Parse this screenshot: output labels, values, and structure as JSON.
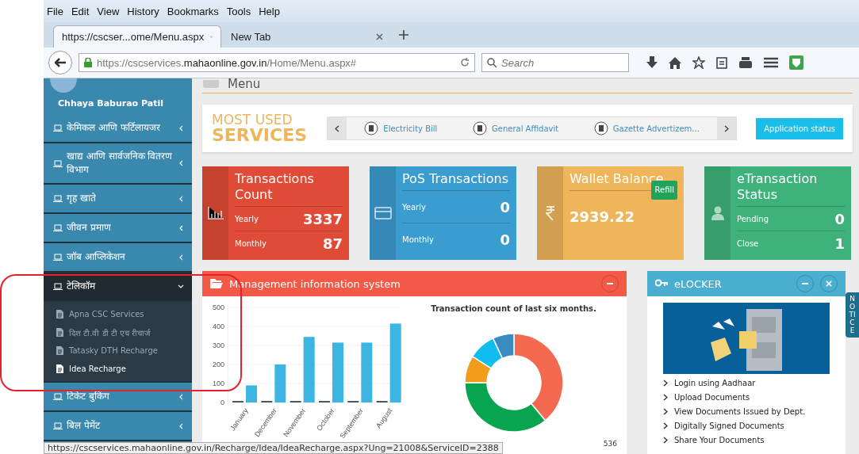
{
  "menu_bar": [
    "File",
    "Edit",
    "View",
    "History",
    "Bookmarks",
    "Tools",
    "Help"
  ],
  "tabs": [
    {
      "label": "https://cscser...ome/Menu.aspx",
      "selected": true
    },
    {
      "label": "New Tab",
      "selected": false
    }
  ],
  "address_bar": {
    "url": "https://cscservices.**mahaonline.gov.in**/Home/Menu.aspx#"
  },
  "search": {
    "placeholder": "Search"
  },
  "sidebar": {
    "user_name": "Chhaya Baburao Patil",
    "items": [
      {
        "label": "केमिकल आणि फर्टिलायजर",
        "expanded": false
      },
      {
        "label": "खाद्य आणि सार्वजनिक वितरण विभाग",
        "expanded": false
      },
      {
        "label": "गृह खाते",
        "expanded": false
      },
      {
        "label": "जीवन प्रमाण",
        "expanded": false
      },
      {
        "label": "जॉब आप्लिकेशन",
        "expanded": false
      },
      {
        "label": "टेलिकॉम",
        "expanded": true,
        "children": [
          {
            "label": "Apna CSC Services",
            "selected": false
          },
          {
            "label": "दिश टी.वी डी टी एच रीचार्ज",
            "selected": false
          },
          {
            "label": "Tatasky DTH Recharge",
            "selected": false
          },
          {
            "label": "Idea Recharge",
            "selected": true
          }
        ]
      },
      {
        "label": "टिकेट बुकिंग",
        "expanded": false
      },
      {
        "label": "बिल पेमेंट",
        "expanded": false
      }
    ]
  },
  "page_title": "Menu",
  "most_used": {
    "title_top": "MOST USED",
    "title_bottom": "SERVICES",
    "services": [
      "Electricity Bill",
      "General Affidavit",
      "Gazette Advertizem..."
    ],
    "button": "Application status"
  },
  "stat_cards": [
    {
      "kind": "rows",
      "color": "#e04b37",
      "title": "Transactions Count",
      "rows": [
        {
          "label": "Yearly",
          "value": "3337"
        },
        {
          "label": "Monthly",
          "value": "87"
        }
      ]
    },
    {
      "kind": "rows",
      "color": "#3b9ccf",
      "title": "PoS Transactions",
      "rows": [
        {
          "label": "Yearly",
          "value": "0"
        },
        {
          "label": "Monthly",
          "value": "0"
        }
      ]
    },
    {
      "kind": "balance",
      "color": "#eeb55b",
      "title": "Wallet Balance",
      "badge": "Refill",
      "value": "2939.22"
    },
    {
      "kind": "rows",
      "color": "#3fb27b",
      "title": "eTransaction Status",
      "rows": [
        {
          "label": "Pending",
          "value": "0"
        },
        {
          "label": "Close",
          "value": "1"
        }
      ]
    }
  ],
  "mis_panel": {
    "title": "Management information system",
    "chart_data": {
      "type": "bar",
      "categories": [
        "January",
        "December",
        "November",
        "October",
        "September",
        "August"
      ],
      "series": [
        {
          "color": "#4a5866",
          "values": [
            0,
            0,
            0,
            0,
            0,
            0
          ]
        },
        {
          "color": "#3db5e3",
          "values": [
            90,
            200,
            345,
            315,
            315,
            415
          ]
        }
      ],
      "ylim": [
        0,
        500
      ],
      "yticks": [
        0,
        100,
        200,
        300,
        400,
        500
      ],
      "grid": true
    },
    "donut_title": "Transaction count of last six months.",
    "footer_number": "536"
  },
  "elocker": {
    "title": "eLOCKER",
    "links": [
      "Login using Aadhaar",
      "Upload Documents",
      "View Documents Issued by Dept.",
      "Digitally Signed Documents",
      "Share Your Documents"
    ]
  },
  "notice_tab": "NOTICE",
  "status_bar": "https://cscservices.mahaonline.gov.in/Recharge/Idea/IdeaRecharge.aspx?Ung=21008&ServiceID=2388"
}
